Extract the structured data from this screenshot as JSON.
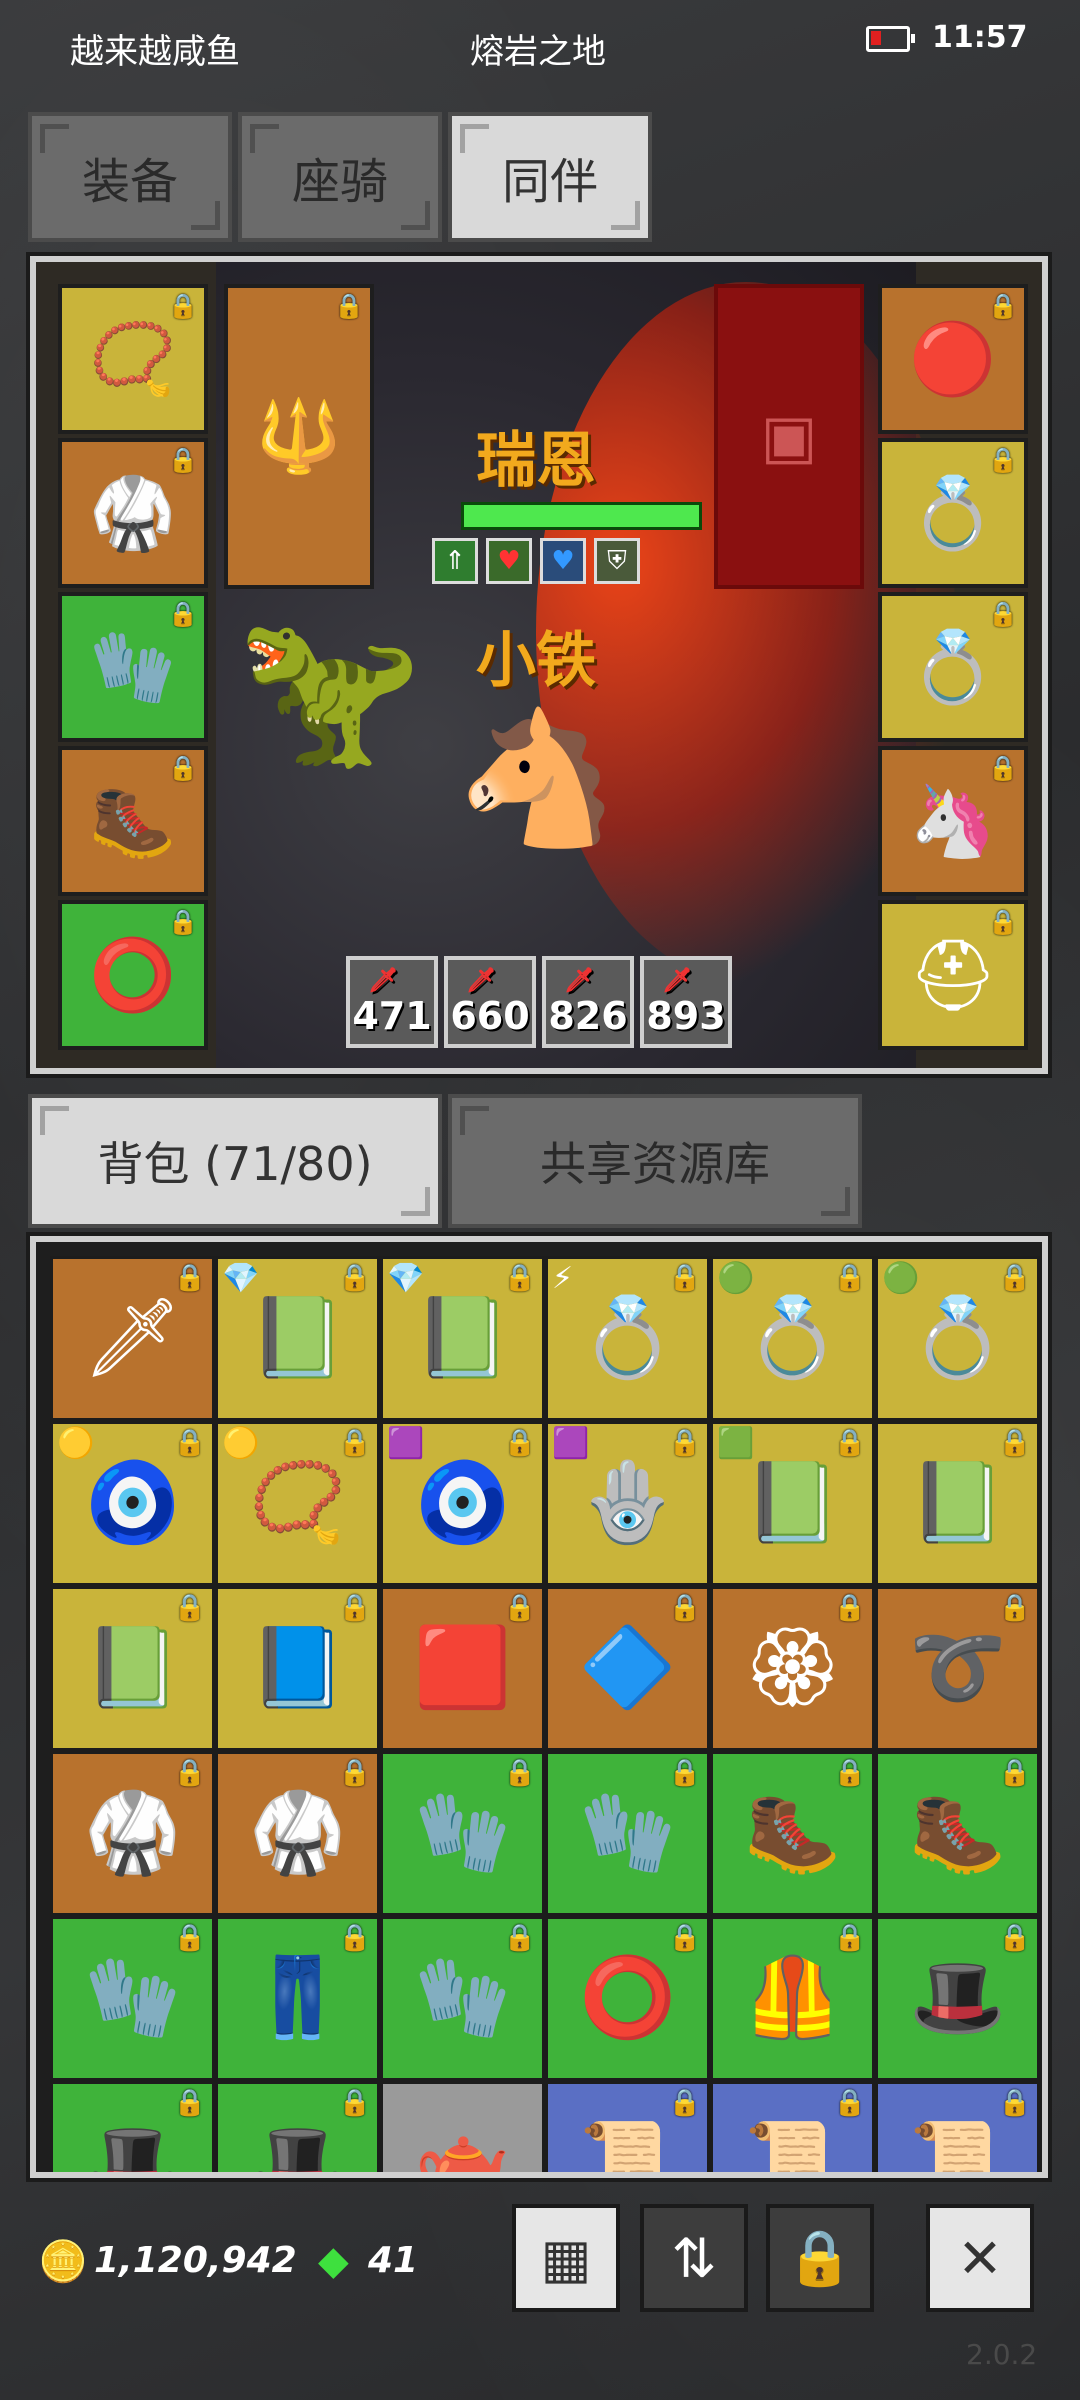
{
  "status": {
    "left_text": "越来越咸鱼",
    "location": "熔岩之地",
    "time": "11:57",
    "battery_level": 0.3
  },
  "top_tabs": [
    {
      "label": "装备",
      "active": false
    },
    {
      "label": "座骑",
      "active": false
    },
    {
      "label": "同伴",
      "active": true
    }
  ],
  "scene": {
    "hero_name": "瑞恩",
    "companion_name": "小铁",
    "hp_fraction": 1.0,
    "stats": [
      "471",
      "660",
      "826",
      "893"
    ]
  },
  "bag_tabs": [
    {
      "label": "背包 (71/80)",
      "active": true
    },
    {
      "label": "共享资源库",
      "active": false
    }
  ],
  "currency": {
    "gold": "1,120,942",
    "gems": "41"
  },
  "version": "2.0.2",
  "colors": {
    "yellow": "#c9b43a",
    "orange": "#b8722d",
    "green": "#3fb33a",
    "blue": "#5a6fc4"
  }
}
